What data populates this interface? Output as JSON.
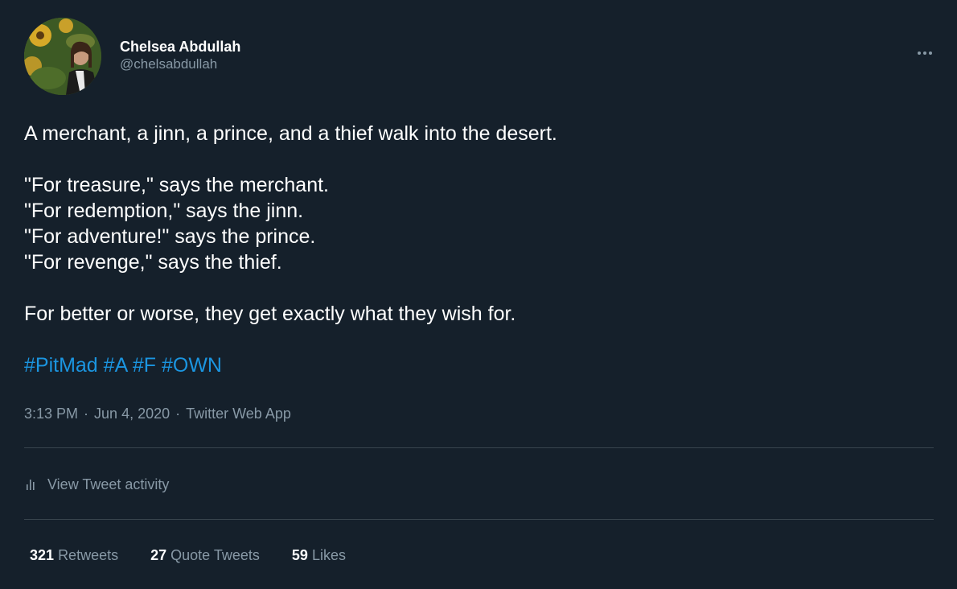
{
  "author": {
    "display_name": "Chelsea Abdullah",
    "handle": "@chelsabdullah",
    "avatar_icon": "profile-photo-sunflowers"
  },
  "menu": {
    "more_icon": "more-dots-icon"
  },
  "tweet": {
    "lines": [
      "A merchant, a jinn, a prince, and a thief walk into the desert.",
      "",
      "\"For treasure,\" says the merchant.",
      "\"For redemption,\" says the jinn.",
      "\"For adventure!\" says the prince.",
      "\"For revenge,\" says the thief.",
      "",
      "For better or worse, they get exactly what they wish for.",
      ""
    ],
    "hashtags": [
      "#PitMad",
      "#A",
      "#F",
      "#OWN"
    ]
  },
  "meta": {
    "time": "3:13 PM",
    "separator": "·",
    "date": "Jun 4, 2020",
    "source": "Twitter Web App"
  },
  "activity": {
    "label": "View Tweet activity",
    "icon": "analytics-bars-icon"
  },
  "stats": {
    "retweets_count": "321",
    "retweets_label": "Retweets",
    "quotes_count": "27",
    "quotes_label": "Quote Tweets",
    "likes_count": "59",
    "likes_label": "Likes"
  },
  "colors": {
    "background": "#15202b",
    "text_primary": "#ffffff",
    "text_secondary": "#8899a6",
    "link": "#1b95e0",
    "divider": "#38444d"
  }
}
